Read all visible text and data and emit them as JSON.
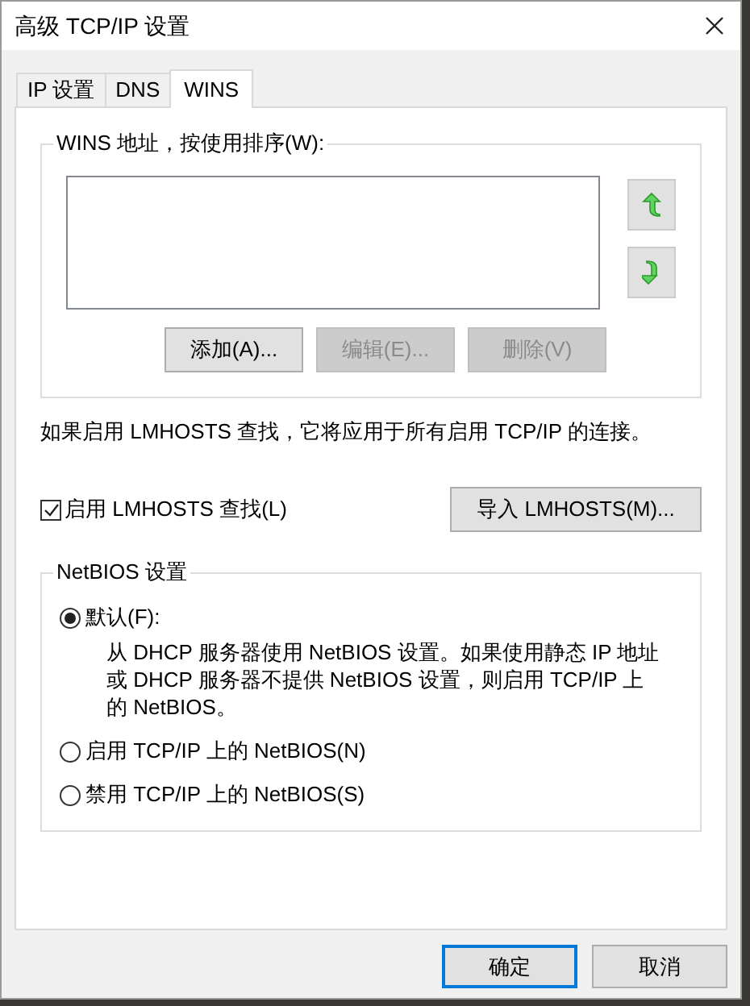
{
  "window": {
    "title": "高级 TCP/IP 设置"
  },
  "tabs": [
    {
      "label": "IP 设置",
      "selected": false
    },
    {
      "label": "DNS",
      "selected": false
    },
    {
      "label": "WINS",
      "selected": true
    }
  ],
  "wins_group": {
    "title": "WINS 地址，按使用排序(W):",
    "buttons": [
      {
        "label": "添加(A)...",
        "disabled": false
      },
      {
        "label": "编辑(E)...",
        "disabled": true
      },
      {
        "label": "删除(V)",
        "disabled": true
      }
    ]
  },
  "info_text": "如果启用 LMHOSTS 查找，它将应用于所有启用 TCP/IP 的连接。",
  "lmhosts_checkbox": {
    "label": "启用 LMHOSTS 查找(L)",
    "checked": true
  },
  "import_button": {
    "label": "导入 LMHOSTS(M)..."
  },
  "netbios_group": {
    "title": "NetBIOS 设置",
    "options": [
      {
        "label": "默认(F):",
        "selected": true,
        "description": "从 DHCP 服务器使用 NetBIOS 设置。如果使用静态 IP 地址或 DHCP 服务器不提供 NetBIOS 设置，则启用 TCP/IP 上的 NetBIOS。"
      },
      {
        "label": "启用 TCP/IP 上的 NetBIOS(N)",
        "selected": false
      },
      {
        "label": "禁用 TCP/IP 上的 NetBIOS(S)",
        "selected": false
      }
    ]
  },
  "dialog_buttons": [
    {
      "label": "确定",
      "default": true
    },
    {
      "label": "取消",
      "default": false
    }
  ]
}
